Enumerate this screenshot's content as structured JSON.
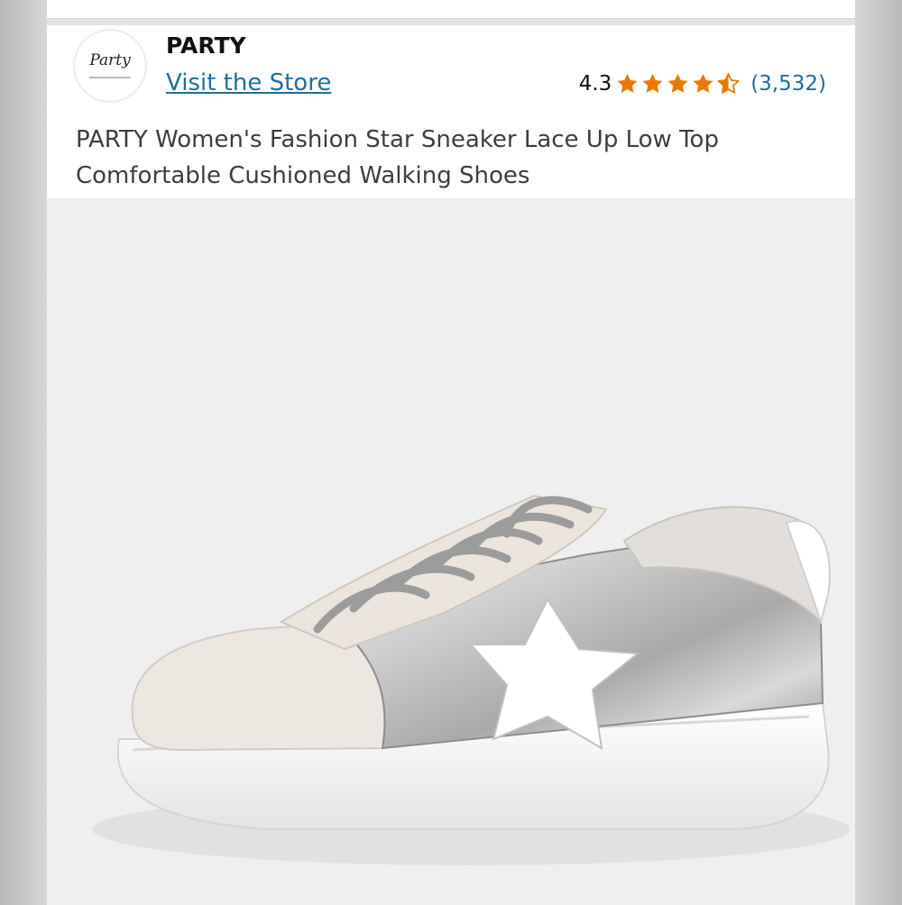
{
  "store": {
    "logo_text": "Party",
    "name": "PARTY",
    "link_label": "Visit the Store"
  },
  "rating": {
    "score": "4.3",
    "stars": 4.3,
    "count": "(3,532)",
    "star_color": "#e67a00"
  },
  "product": {
    "title": "PARTY Women's Fashion Star Sneaker Lace Up Low Top Comfortable Cushioned Walking Shoes",
    "image_icon": "sneaker-image"
  },
  "colors": {
    "link": "#1f6ea0",
    "text": "#0f1111"
  }
}
